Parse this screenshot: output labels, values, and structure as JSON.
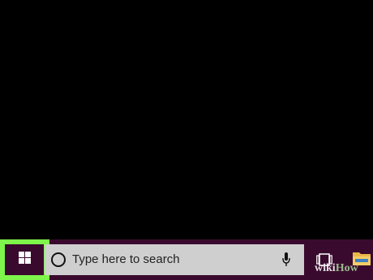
{
  "taskbar": {
    "start_button": {
      "icon": "windows-logo-icon",
      "highlighted": true,
      "highlight_color": "#7df54a"
    },
    "search": {
      "placeholder": "Type here to search",
      "cortana_icon": "cortana-circle-icon",
      "mic_icon": "microphone-icon"
    },
    "task_view_icon": "task-view-icon",
    "file_explorer_icon": "folder-icon",
    "background_color": "#3a0a2e"
  },
  "watermark": {
    "wiki": "wiki",
    "how": "How"
  }
}
